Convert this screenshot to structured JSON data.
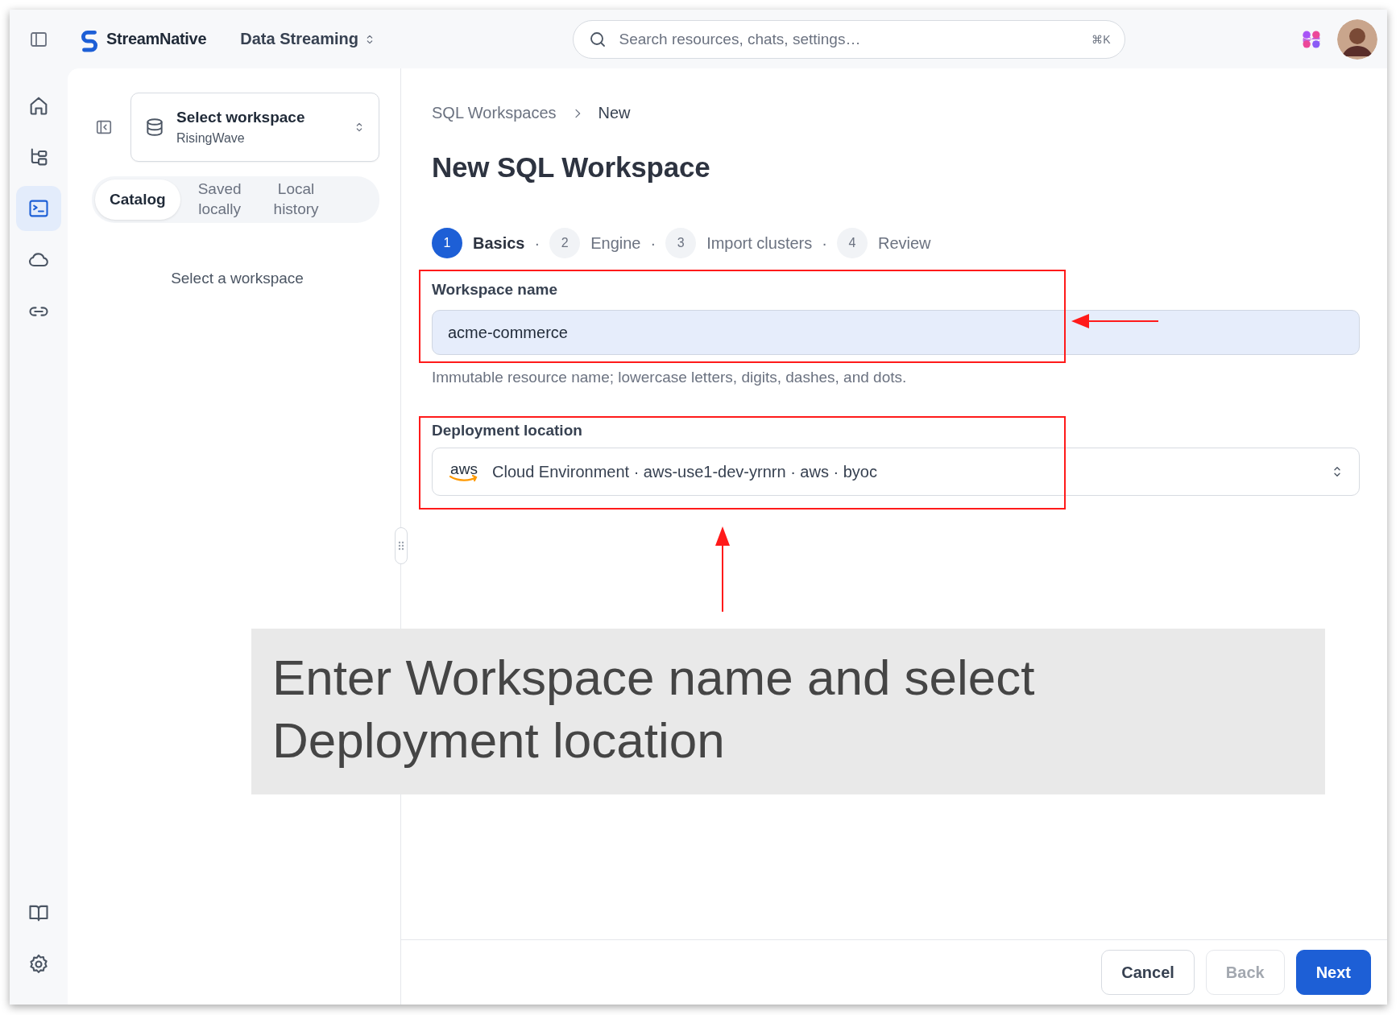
{
  "topbar": {
    "brand": "StreamNative",
    "product": "Data Streaming",
    "search": {
      "placeholder": "Search resources, chats, settings…",
      "shortcut": "⌘K"
    }
  },
  "rail": {
    "top": [
      {
        "kind": "home",
        "selected": false
      },
      {
        "kind": "tree",
        "selected": false
      },
      {
        "kind": "terminal",
        "selected": true
      },
      {
        "kind": "cloud",
        "selected": false
      },
      {
        "kind": "link",
        "selected": false
      }
    ],
    "bottom": [
      {
        "kind": "book",
        "selected": false
      },
      {
        "kind": "settings",
        "selected": false
      }
    ]
  },
  "side_panel": {
    "workspace_select": {
      "title": "Select workspace",
      "value": "RisingWave"
    },
    "tabs": [
      {
        "label": "Catalog",
        "selected": true
      },
      {
        "label": "Saved locally",
        "selected": false
      },
      {
        "label": "Local history",
        "selected": false
      }
    ],
    "empty_text": "Select a workspace"
  },
  "breadcrumb": [
    "SQL Workspaces",
    "New"
  ],
  "title": "New SQL Workspace",
  "steps": [
    {
      "number": "1",
      "label": "Basics",
      "selected": true,
      "separator": "·"
    },
    {
      "number": "2",
      "label": "Engine",
      "selected": false,
      "separator": "·"
    },
    {
      "number": "3",
      "label": "Import clusters",
      "selected": false,
      "separator": "·"
    },
    {
      "number": "4",
      "label": "Review",
      "selected": false
    }
  ],
  "fields": [
    {
      "kind": "text",
      "label": "Workspace name",
      "value": "acme-commerce",
      "help": "Immutable resource name; lowercase letters, digits, dashes, and dots."
    },
    {
      "kind": "select",
      "label": "Deployment location",
      "logo_text": "aws",
      "value": "Cloud Environment · aws-use1-dev-yrnrn · aws · byoc"
    }
  ],
  "buttons": [
    {
      "label": "Cancel",
      "kind": "secondary",
      "disabled": false
    },
    {
      "label": "Back",
      "kind": "secondary",
      "disabled": true
    },
    {
      "label": "Next",
      "kind": "primary",
      "disabled": false
    }
  ],
  "annotation": {
    "caption": "Enter Workspace name and select Deployment location"
  }
}
